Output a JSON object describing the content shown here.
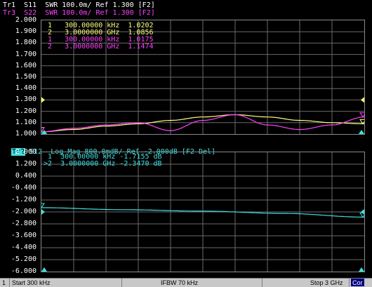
{
  "upper": {
    "traces": [
      {
        "id": "Tr1",
        "text": "Tr1  S11  SWR 100.0m/ Ref 1.300 [F2]",
        "color": "#ffffff"
      },
      {
        "id": "Tr3",
        "text": "Tr3  S22  SWR 100.0m/ Ref 1.300 [F2]",
        "color": "#ff40ff"
      }
    ],
    "y_labels": [
      "2.000",
      "1.900",
      "1.800",
      "1.700",
      "1.600",
      "1.500",
      "1.400",
      "1.300",
      "1.200",
      "1.100",
      "1.000"
    ],
    "markers": [
      {
        "num": "1",
        "freq": "300.00000 kHz",
        "value": "1.0202",
        "color": "#ffff80"
      },
      {
        "num": "2",
        "freq": "3.0000000 GHz",
        "value": "1.0856",
        "color": "#ffff80"
      },
      {
        "num": "1",
        "freq": "300.00000 kHz",
        "value": "1.0175",
        "color": "#ff40ff"
      },
      {
        "num": "2",
        "freq": "3.0000000 GHz",
        "value": "1.1474",
        "color": "#ff40ff"
      }
    ]
  },
  "lower": {
    "trace": {
      "id": "Tr2",
      "text": "S12  Log Mag 800.0mdB/ Ref -2.000dB [F2 Del]",
      "color": "#40e0e0"
    },
    "y_labels": [
      "2.000",
      "1.200",
      "0.400",
      "-0.400",
      "-1.200",
      "-2.000",
      "-2.800",
      "-3.600",
      "-4.400",
      "-5.200",
      "-6.000"
    ],
    "markers": [
      {
        "num": " 1",
        "freq": "300.00000 kHz",
        "value": "-1.7155 dB"
      },
      {
        "num": ">2",
        "freq": "3.0000000 GHz",
        "value": "-2.3470 dB"
      }
    ]
  },
  "chart_data": [
    {
      "type": "line",
      "ylim": [
        1.0,
        2.0
      ],
      "x": [
        0,
        0.1,
        0.2,
        0.3,
        0.4,
        0.5,
        0.6,
        0.7,
        0.8,
        0.9,
        1.0
      ],
      "series": [
        {
          "name": "S11",
          "color": "#ffff80",
          "values": [
            1.02,
            1.04,
            1.07,
            1.09,
            1.12,
            1.15,
            1.17,
            1.15,
            1.12,
            1.1,
            1.09
          ]
        },
        {
          "name": "S22",
          "color": "#ff40ff",
          "values": [
            1.02,
            1.05,
            1.08,
            1.1,
            1.03,
            1.12,
            1.17,
            1.08,
            1.04,
            1.08,
            1.15
          ]
        }
      ]
    },
    {
      "type": "line",
      "ylim": [
        -6.0,
        2.0
      ],
      "x": [
        0,
        0.25,
        0.5,
        0.75,
        1.0
      ],
      "series": [
        {
          "name": "S12",
          "color": "#40e0e0",
          "values": [
            -1.7155,
            -1.85,
            -1.95,
            -2.1,
            -2.347
          ]
        }
      ]
    }
  ],
  "status": {
    "channel": "1",
    "start": "Start 300 kHz",
    "ifbw": "IFBW 70 kHz",
    "stop": "Stop 3 GHz",
    "cor": "Cor"
  }
}
